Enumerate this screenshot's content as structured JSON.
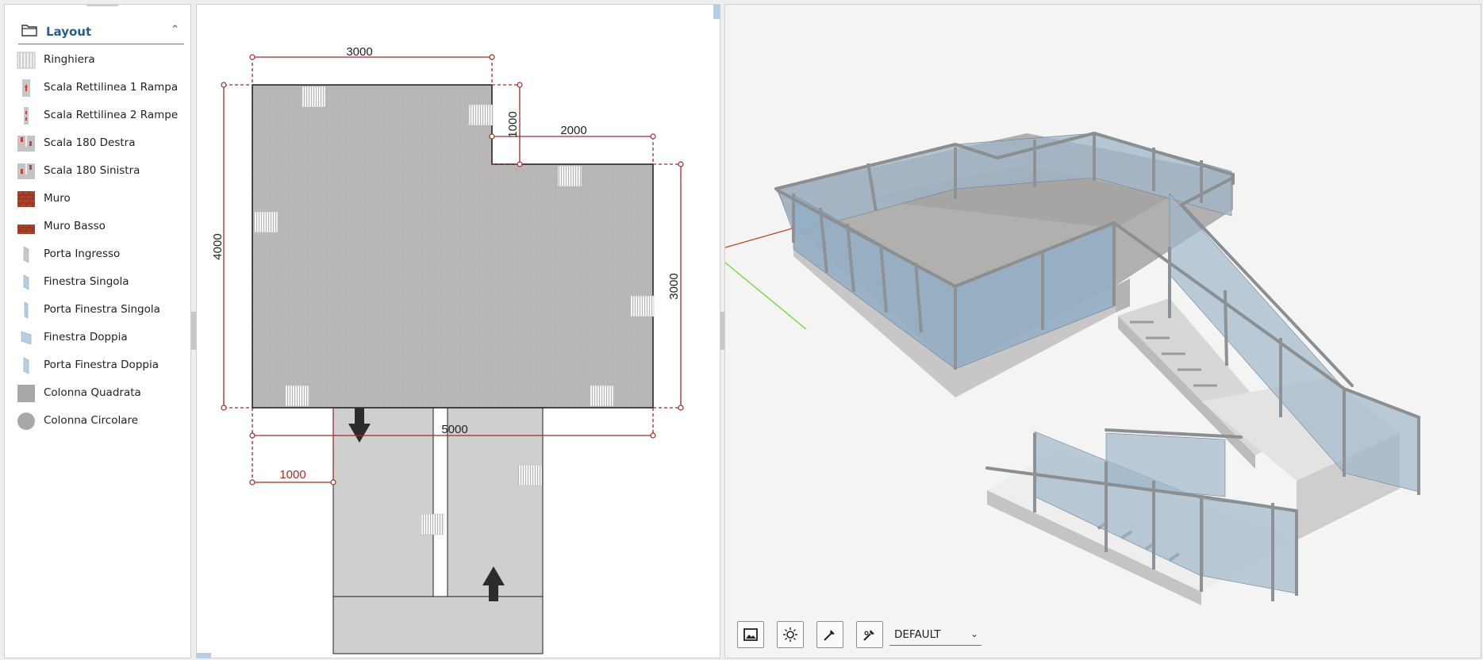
{
  "sidebar": {
    "section_title": "Layout",
    "items": [
      {
        "label": "Ringhiera",
        "icon": "railing-icon"
      },
      {
        "label": "Scala Rettilinea 1 Rampa",
        "icon": "straight-stair-icon"
      },
      {
        "label": "Scala Rettilinea 2 Rampe",
        "icon": "straight-stair-2-icon"
      },
      {
        "label": "Scala 180 Destra",
        "icon": "u-stair-right-icon"
      },
      {
        "label": "Scala 180 Sinistra",
        "icon": "u-stair-left-icon"
      },
      {
        "label": "Muro",
        "icon": "brick-wall-icon"
      },
      {
        "label": "Muro Basso",
        "icon": "low-wall-icon"
      },
      {
        "label": "Porta Ingresso",
        "icon": "entrance-door-icon"
      },
      {
        "label": "Finestra Singola",
        "icon": "single-window-icon"
      },
      {
        "label": "Porta Finestra Singola",
        "icon": "single-french-door-icon"
      },
      {
        "label": "Finestra Doppia",
        "icon": "double-window-icon"
      },
      {
        "label": "Porta Finestra Doppia",
        "icon": "double-french-door-icon"
      },
      {
        "label": "Colonna Quadrata",
        "icon": "square-column-icon"
      },
      {
        "label": "Colonna Circolare",
        "icon": "round-column-icon"
      }
    ]
  },
  "plan": {
    "dimensions": {
      "top_width": "3000",
      "notch_height": "1000",
      "notch_width": "2000",
      "left_height": "4000",
      "right_height": "3000",
      "bottom_width": "5000",
      "stair_offset": "1000"
    }
  },
  "view3d": {
    "toolbar": {
      "buttons": [
        "image-icon",
        "light-icon",
        "pipette-icon",
        "pipette-settings-icon"
      ],
      "preset_value": "DEFAULT"
    }
  },
  "colors": {
    "accent": "#2a5d8c",
    "dimension_line": "#a52a2a",
    "floor": "#b9b6b6",
    "stair": "#cfcfcf",
    "glass": "#9fb6c9"
  }
}
